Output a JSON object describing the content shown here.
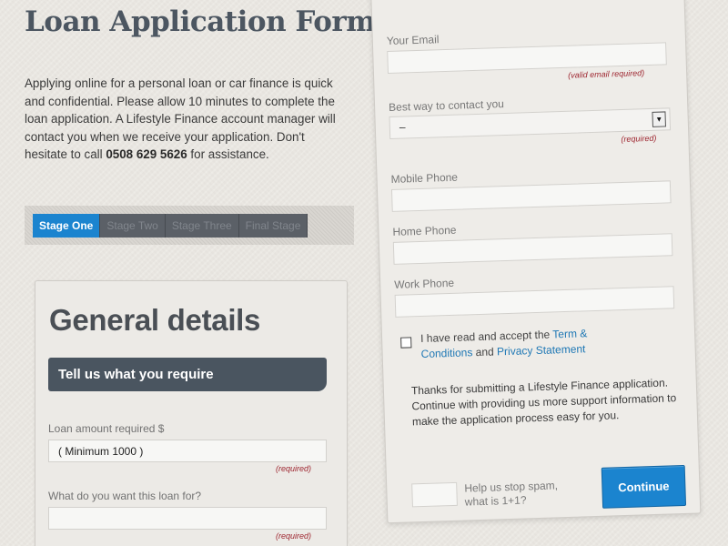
{
  "header": {
    "title": "Loan Application Form"
  },
  "intro": {
    "text_before": "Applying online for a personal loan or car finance is quick and confidential. Please allow 10 minutes to complete the loan application. A Lifestyle Finance account manager will contact you when we receive your application. Don't hesitate to call ",
    "phone": "0508 629 5626",
    "text_after": " for assistance."
  },
  "stages": [
    {
      "label": "Stage One",
      "active": true
    },
    {
      "label": "Stage Two",
      "active": false
    },
    {
      "label": "Stage Three",
      "active": false
    },
    {
      "label": "Final Stage",
      "active": false
    }
  ],
  "general": {
    "heading": "General details",
    "banner": "Tell us what you require",
    "loan_amount": {
      "label": "Loan amount required $",
      "value": "( Minimum 1000 )",
      "required": "(required)"
    },
    "loan_purpose": {
      "label": "What do you want this loan for?",
      "value": "",
      "required": "(required)"
    }
  },
  "contact": {
    "email": {
      "label": "Your Email",
      "value": "",
      "required": "(valid email required)"
    },
    "best_way": {
      "label": "Best way to contact you",
      "selected": "–",
      "required": "(required)"
    },
    "mobile": {
      "label": "Mobile Phone",
      "value": ""
    },
    "home": {
      "label": "Home Phone",
      "value": ""
    },
    "work": {
      "label": "Work Phone",
      "value": ""
    },
    "terms": {
      "text_before": "I have read and accept the ",
      "link1": "Term & Conditions",
      "text_mid": " and ",
      "link2": "Privacy Statement"
    },
    "thanks": "Thanks for submitting a Lifestyle Finance application. Continue with providing us more support information to make the application process easy for you.",
    "spam": {
      "label": "Help us stop spam, what is 1+1?",
      "value": ""
    },
    "continue_label": "Continue"
  },
  "colors": {
    "accent": "#1b84cf",
    "banner": "#4a5560",
    "required": "#9e2630",
    "link": "#1f78b5"
  }
}
